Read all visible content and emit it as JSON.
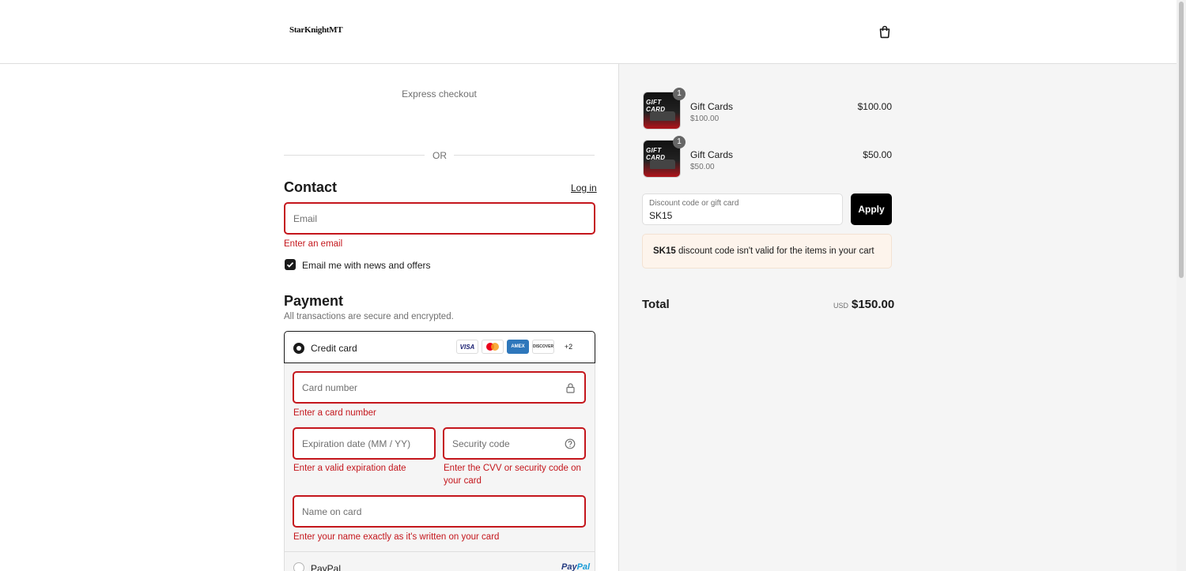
{
  "header": {
    "logo_text": "StarKnightMT",
    "cart_icon": "shopping-bag-icon"
  },
  "express_checkout": {
    "label": "Express checkout",
    "divider_text": "OR"
  },
  "contact": {
    "heading": "Contact",
    "login_link": "Log in",
    "email_placeholder": "Email",
    "email_error": "Enter an email",
    "newsletter_label": "Email me with news and offers",
    "newsletter_checked": true
  },
  "payment": {
    "heading": "Payment",
    "subtitle": "All transactions are secure and encrypted.",
    "credit_card_label": "Credit card",
    "card_brands": [
      "VISA",
      "Mastercard",
      "AMEX",
      "DISCOVER"
    ],
    "more_brands": "+2",
    "card_number_placeholder": "Card number",
    "card_number_error": "Enter a card number",
    "expiry_placeholder": "Expiration date (MM / YY)",
    "expiry_error": "Enter a valid expiration date",
    "cvv_placeholder": "Security code",
    "cvv_error": "Enter the CVV or security code on your card",
    "name_placeholder": "Name on card",
    "name_error": "Enter your name exactly as it's written on your card",
    "paypal_label": "PayPal",
    "paypal_logo_a": "Pay",
    "paypal_logo_b": "Pal"
  },
  "order": {
    "items": [
      {
        "thumb_text": "GIFT CARD",
        "quantity": "1",
        "name": "Gift Cards",
        "sub": "$100.00",
        "price": "$100.00"
      },
      {
        "thumb_text": "GIFT CARD",
        "quantity": "1",
        "name": "Gift Cards",
        "sub": "$50.00",
        "price": "$50.00"
      }
    ],
    "discount_label": "Discount code or gift card",
    "discount_value": "SK15",
    "apply_label": "Apply",
    "warning_code": "SK15",
    "warning_text": " discount code isn't valid for the items in your cart",
    "total_label": "Total",
    "currency": "USD",
    "total_value": "$150.00"
  },
  "colors": {
    "error": "#c4161c",
    "button": "#000000",
    "summary_bg": "#f5f5f5",
    "warning_bg": "#fdf4ec"
  }
}
